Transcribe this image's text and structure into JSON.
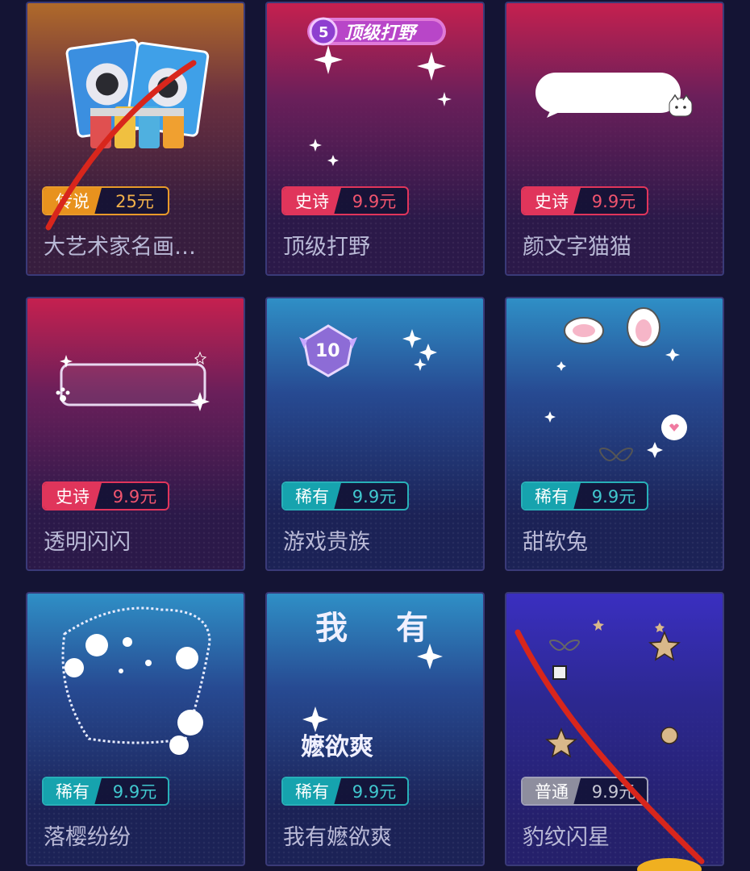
{
  "items": [
    {
      "name": "大艺术家名画…",
      "tier": "传说",
      "price": "25元",
      "tier_type": "legend"
    },
    {
      "name": "顶级打野",
      "tier": "史诗",
      "price": "9.9元",
      "tier_type": "epic"
    },
    {
      "name": "颜文字猫猫",
      "tier": "史诗",
      "price": "9.9元",
      "tier_type": "epic"
    },
    {
      "name": "透明闪闪",
      "tier": "史诗",
      "price": "9.9元",
      "tier_type": "epic"
    },
    {
      "name": "游戏贵族",
      "tier": "稀有",
      "price": "9.9元",
      "tier_type": "rare"
    },
    {
      "name": "甜软兔",
      "tier": "稀有",
      "price": "9.9元",
      "tier_type": "rare"
    },
    {
      "name": "落樱纷纷",
      "tier": "稀有",
      "price": "9.9元",
      "tier_type": "rare"
    },
    {
      "name": "我有嬷欲爽",
      "tier": "稀有",
      "price": "9.9元",
      "tier_type": "rare"
    },
    {
      "name": "豹纹闪星",
      "tier": "普通",
      "price": "9.9元",
      "tier_type": "common"
    }
  ],
  "previews": {
    "jungle_banner": "顶级打野",
    "bubble_level": "10",
    "text_line1_a": "我",
    "text_line1_b": "有",
    "text_line2": "嬷欲爽"
  },
  "colors": {
    "legend": "#e8921e",
    "epic": "#e0355b",
    "rare": "#16a3ae",
    "common": "#8e8e9e",
    "annotation_stroke": "#d8261c"
  }
}
